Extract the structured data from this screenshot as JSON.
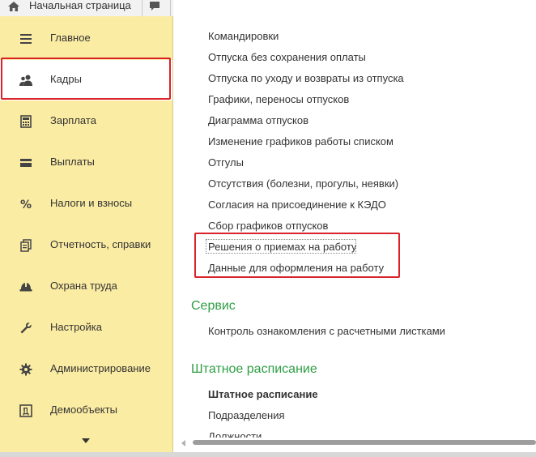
{
  "top_tabs": {
    "home_label": "Начальная страница"
  },
  "sidebar": {
    "items": [
      {
        "label": "Главное",
        "icon": "menu-lines-icon",
        "active": false
      },
      {
        "label": "Кадры",
        "icon": "users-icon",
        "active": true
      },
      {
        "label": "Зарплата",
        "icon": "calculator-icon",
        "active": false
      },
      {
        "label": "Выплаты",
        "icon": "wallet-icon",
        "active": false
      },
      {
        "label": "Налоги и взносы",
        "icon": "percent-icon",
        "active": false
      },
      {
        "label": "Отчетность, справки",
        "icon": "documents-icon",
        "active": false
      },
      {
        "label": "Охрана труда",
        "icon": "hard-hat-icon",
        "active": false
      },
      {
        "label": "Настройка",
        "icon": "wrench-icon",
        "active": false
      },
      {
        "label": "Администрирование",
        "icon": "gear-icon",
        "active": false
      },
      {
        "label": "Демообъекты",
        "icon": "demo-d-icon",
        "active": false
      }
    ]
  },
  "content": {
    "links": [
      "Командировки",
      "Отпуска без сохранения оплаты",
      "Отпуска по уходу и возвраты из отпуска",
      "Графики, переносы отпусков",
      "Диаграмма отпусков",
      "Изменение графиков работы списком",
      "Отгулы",
      "Отсутствия (болезни, прогулы, неявки)",
      "Согласия на присоединение к КЭДО",
      "Сбор графиков отпусков",
      "Решения о приемах на работу",
      "Данные для оформления на работу"
    ],
    "service": {
      "title": "Сервис",
      "links": [
        "Контроль ознакомления с расчетными листками"
      ]
    },
    "staffing": {
      "title": "Штатное расписание",
      "links": [
        "Штатное расписание",
        "Подразделения",
        "Должности"
      ]
    }
  },
  "colors": {
    "sidebar_bg": "#fbeca3",
    "section_title": "#2e9e44",
    "highlight": "#d9222a"
  }
}
